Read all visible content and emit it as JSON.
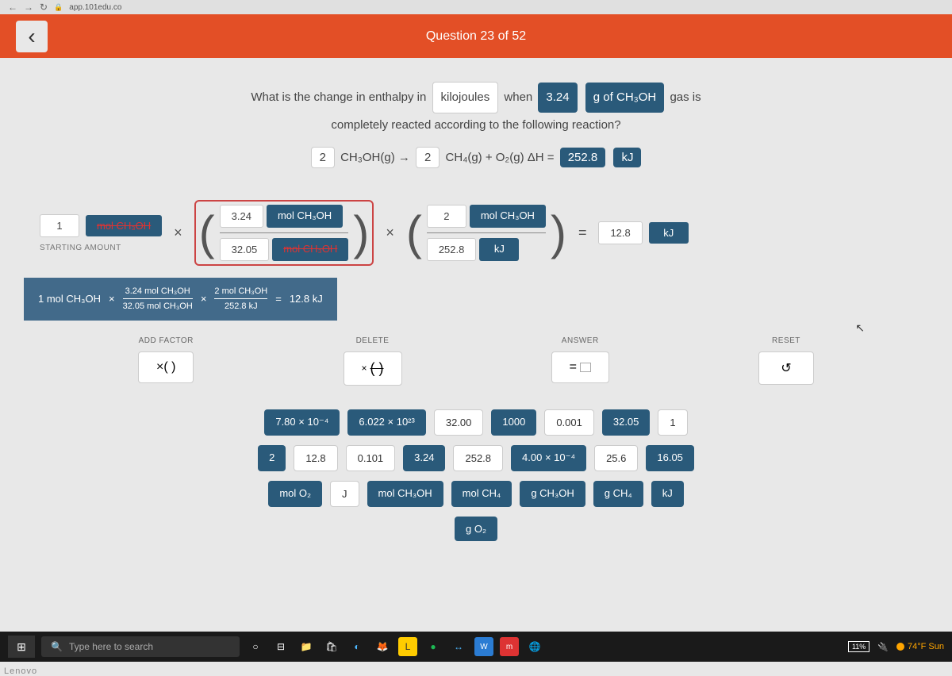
{
  "browser": {
    "url": "app.101edu.co"
  },
  "header": {
    "title": "Question 23 of 52"
  },
  "question": {
    "line1_pre": "What is the change in enthalpy in",
    "pill_kj": "kilojoules",
    "line1_mid": "when",
    "pill_mass": "3.24",
    "pill_substance": "g of CH₃OH",
    "line1_post": "gas is",
    "line2": "completely reacted according to the following reaction?",
    "reaction": {
      "coef1": "2",
      "reactant": "CH₃OH(g) →",
      "coef2": "2",
      "products": "CH₄(g) + O₂(g) ΔH =",
      "dh_val": "252.8",
      "dh_unit": "kJ"
    }
  },
  "workspace": {
    "start_val": "1",
    "start_unit": "mol CH₃OH",
    "start_label": "STARTING AMOUNT",
    "factor1": {
      "top_val": "3.24",
      "top_unit": "mol CH₃OH",
      "bot_val": "32.05",
      "bot_unit": "mol CH₃OH"
    },
    "factor2": {
      "top_val": "2",
      "top_unit": "mol CH₃OH",
      "bot_val": "252.8",
      "bot_unit": "kJ"
    },
    "result_val": "12.8",
    "result_unit": "kJ"
  },
  "summary": {
    "start": "1 mol CH₃OH",
    "f1_top": "3.24 mol CH₃OH",
    "f1_bot": "32.05 mol CH₃OH",
    "f2_top": "2 mol CH₃OH",
    "f2_bot": "252.8 kJ",
    "result": "12.8 kJ"
  },
  "controls": {
    "add_factor": "ADD FACTOR",
    "delete": "DELETE",
    "answer": "ANSWER",
    "reset": "RESET",
    "add_sym": "×( )",
    "reset_sym": "↺"
  },
  "tiles": {
    "row1": [
      "7.80 × 10⁻⁴",
      "6.022 × 10²³",
      "32.00",
      "1000",
      "0.001",
      "32.05",
      "1"
    ],
    "row2": [
      "2",
      "12.8",
      "0.101",
      "3.24",
      "252.8",
      "4.00 × 10⁻⁴",
      "25.6",
      "16.05"
    ],
    "row3": [
      "mol O₂",
      "J",
      "mol CH₃OH",
      "mol CH₄",
      "g CH₃OH",
      "g CH₄",
      "kJ"
    ],
    "row4": [
      "g O₂"
    ]
  },
  "taskbar": {
    "search_placeholder": "Type here to search",
    "battery": "11%",
    "weather": "74°F Sun"
  },
  "brand": "Lenovo"
}
